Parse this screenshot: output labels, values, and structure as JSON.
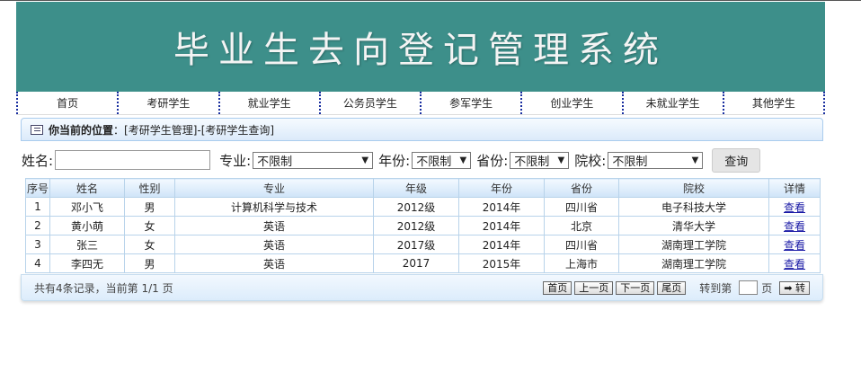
{
  "banner": {
    "title": "毕业生去向登记管理系统"
  },
  "nav": [
    "首页",
    "考研学生",
    "就业学生",
    "公务员学生",
    "参军学生",
    "创业学生",
    "未就业学生",
    "其他学生"
  ],
  "breadcrumb": {
    "label": "你当前的位置",
    "path": "：[考研学生管理]-[考研学生查询]"
  },
  "filters": {
    "name_label": "姓名:",
    "major_label": "专业:",
    "major_value": "不限制",
    "year_label": "年份:",
    "year_value": "不限制",
    "province_label": "省份:",
    "province_value": "不限制",
    "school_label": "院校:",
    "school_value": "不限制",
    "query_label": "查询"
  },
  "table": {
    "headers": [
      "序号",
      "姓名",
      "性别",
      "专业",
      "年级",
      "年份",
      "省份",
      "院校",
      "详情"
    ],
    "rows": [
      [
        "1",
        "邓小飞",
        "男",
        "计算机科学与技术",
        "2012级",
        "2014年",
        "四川省",
        "电子科技大学",
        "查看"
      ],
      [
        "2",
        "黄小萌",
        "女",
        "英语",
        "2012级",
        "2014年",
        "北京",
        "清华大学",
        "查看"
      ],
      [
        "3",
        "张三",
        "女",
        "英语",
        "2017级",
        "2014年",
        "四川省",
        "湖南理工学院",
        "查看"
      ],
      [
        "4",
        "李四无",
        "男",
        "英语",
        "2017",
        "2015年",
        "上海市",
        "湖南理工学院",
        "查看"
      ]
    ]
  },
  "pager": {
    "summary": "共有4条记录，当前第 1/1 页",
    "first": "首页",
    "prev": "上一页",
    "next": "下一页",
    "last": "尾页",
    "goto_label": "转到第",
    "page_suffix": "页",
    "go": "➡ 转"
  }
}
